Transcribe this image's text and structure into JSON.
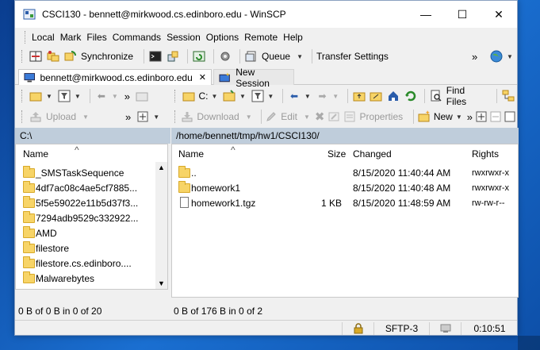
{
  "window": {
    "title": "CSCI130 - bennett@mirkwood.cs.edinboro.edu - WinSCP",
    "minimize": "—",
    "maximize": "☐",
    "close": "✕"
  },
  "menu": [
    "Local",
    "Mark",
    "Files",
    "Commands",
    "Session",
    "Options",
    "Remote",
    "Help"
  ],
  "toolbar1": {
    "synchronize": "Synchronize",
    "queue": "Queue",
    "transfer_settings": "Transfer Settings",
    "overflow": "»"
  },
  "tabs": {
    "session_tab": "bennett@mirkwood.cs.edinboro.edu",
    "session_close": "✕",
    "new_session": "New Session"
  },
  "local_toolbar": {
    "upload": "Upload",
    "overflow": "»"
  },
  "remote_toolbar": {
    "drive_select": "C:",
    "find_files": "Find Files",
    "download": "Download",
    "edit": "Edit",
    "properties": "Properties",
    "new": "New",
    "overflow": "»"
  },
  "local": {
    "path": "C:\\",
    "header_name": "Name",
    "items": [
      "_SMSTaskSequence",
      "4df7ac08c4ae5cf7885...",
      "5f5e59022e11b5d37f3...",
      "7294adb9529c332922...",
      "AMD",
      "filestore",
      "filestore.cs.edinboro....",
      "Malwarebytes"
    ],
    "status": "0 B of 0 B in 0 of 20"
  },
  "remote": {
    "path": "/home/bennett/tmp/hw1/CSCI130/",
    "headers": {
      "name": "Name",
      "size": "Size",
      "changed": "Changed",
      "rights": "Rights"
    },
    "rows": [
      {
        "name": "..",
        "size": "",
        "changed": "8/15/2020 11:40:44 AM",
        "rights": "rwxrwxr-x"
      },
      {
        "name": "homework1",
        "size": "",
        "changed": "8/15/2020 11:40:48 AM",
        "rights": "rwxrwxr-x"
      },
      {
        "name": "homework1.tgz",
        "size": "1 KB",
        "changed": "8/15/2020 11:48:59 AM",
        "rights": "rw-rw-r--"
      }
    ],
    "status": "0 B of 176 B in 0 of 2"
  },
  "statusbar": {
    "protocol": "SFTP-3",
    "time": "0:10:51"
  }
}
